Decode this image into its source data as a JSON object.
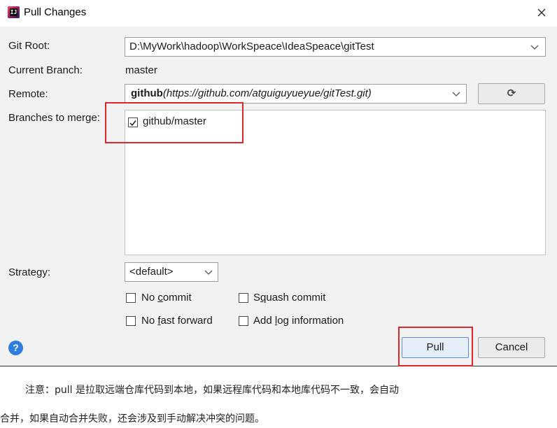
{
  "window": {
    "title": "Pull Changes",
    "close_glyph": "×"
  },
  "form": {
    "git_root_label": "Git Root:",
    "git_root_value": "D:\\MyWork\\hadoop\\WorkSpeace\\IdeaSpeace\\gitTest",
    "current_branch_label": "Current Branch:",
    "current_branch_value": "master",
    "remote_label": "Remote:",
    "remote_name": "github",
    "remote_url": "(https://github.com/atguiguyueyue/gitTest.git)",
    "refresh_glyph": "⟳",
    "branches_label": "Branches to merge:",
    "branches": [
      {
        "name": "github/master",
        "checked": true
      }
    ],
    "strategy_label": "Strategy:",
    "strategy_value": "<default>"
  },
  "options": {
    "no_commit": {
      "before": "No ",
      "mnemonic": "c",
      "after": "ommit",
      "checked": false
    },
    "squash_commit": {
      "before": "S",
      "mnemonic": "q",
      "after": "uash commit",
      "checked": false
    },
    "no_fast_forward": {
      "before": "No ",
      "mnemonic": "f",
      "after": "ast forward",
      "checked": false
    },
    "add_log": {
      "before": "Add ",
      "mnemonic": "l",
      "after": "og information",
      "checked": false
    }
  },
  "buttons": {
    "help": "?",
    "pull": "Pull",
    "cancel": "Cancel"
  },
  "note": {
    "line1": "注意：pull 是拉取远端仓库代码到本地，如果远程库代码和本地库代码不一致，会自动",
    "line2": "合并，如果自动合并失败，还会涉及到手动解决冲突的问题。"
  },
  "colors": {
    "highlight_border": "#e0262b",
    "help_icon": "#2f7de1"
  }
}
